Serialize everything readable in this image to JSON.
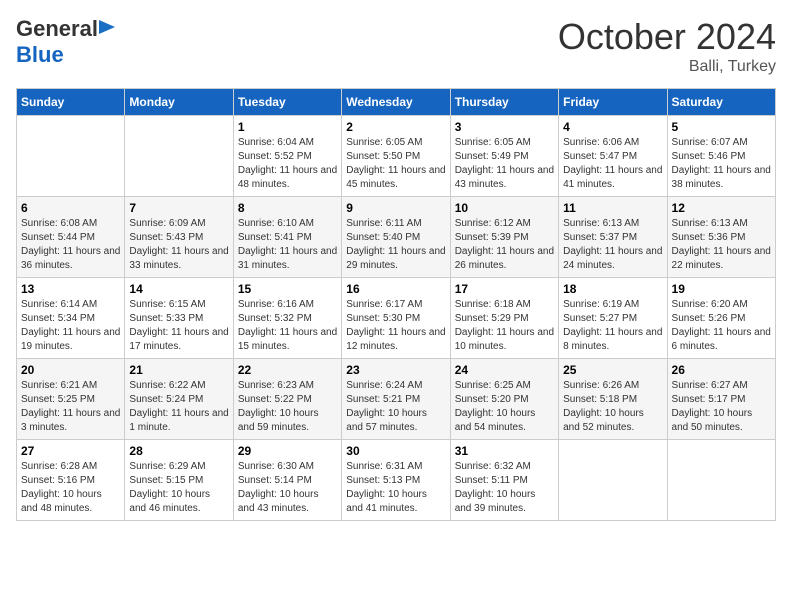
{
  "logo": {
    "general": "General",
    "blue": "Blue"
  },
  "title": "October 2024",
  "location": "Balli, Turkey",
  "days_header": [
    "Sunday",
    "Monday",
    "Tuesday",
    "Wednesday",
    "Thursday",
    "Friday",
    "Saturday"
  ],
  "weeks": [
    [
      {
        "day": "",
        "info": ""
      },
      {
        "day": "",
        "info": ""
      },
      {
        "day": "1",
        "info": "Sunrise: 6:04 AM\nSunset: 5:52 PM\nDaylight: 11 hours and 48 minutes."
      },
      {
        "day": "2",
        "info": "Sunrise: 6:05 AM\nSunset: 5:50 PM\nDaylight: 11 hours and 45 minutes."
      },
      {
        "day": "3",
        "info": "Sunrise: 6:05 AM\nSunset: 5:49 PM\nDaylight: 11 hours and 43 minutes."
      },
      {
        "day": "4",
        "info": "Sunrise: 6:06 AM\nSunset: 5:47 PM\nDaylight: 11 hours and 41 minutes."
      },
      {
        "day": "5",
        "info": "Sunrise: 6:07 AM\nSunset: 5:46 PM\nDaylight: 11 hours and 38 minutes."
      }
    ],
    [
      {
        "day": "6",
        "info": "Sunrise: 6:08 AM\nSunset: 5:44 PM\nDaylight: 11 hours and 36 minutes."
      },
      {
        "day": "7",
        "info": "Sunrise: 6:09 AM\nSunset: 5:43 PM\nDaylight: 11 hours and 33 minutes."
      },
      {
        "day": "8",
        "info": "Sunrise: 6:10 AM\nSunset: 5:41 PM\nDaylight: 11 hours and 31 minutes."
      },
      {
        "day": "9",
        "info": "Sunrise: 6:11 AM\nSunset: 5:40 PM\nDaylight: 11 hours and 29 minutes."
      },
      {
        "day": "10",
        "info": "Sunrise: 6:12 AM\nSunset: 5:39 PM\nDaylight: 11 hours and 26 minutes."
      },
      {
        "day": "11",
        "info": "Sunrise: 6:13 AM\nSunset: 5:37 PM\nDaylight: 11 hours and 24 minutes."
      },
      {
        "day": "12",
        "info": "Sunrise: 6:13 AM\nSunset: 5:36 PM\nDaylight: 11 hours and 22 minutes."
      }
    ],
    [
      {
        "day": "13",
        "info": "Sunrise: 6:14 AM\nSunset: 5:34 PM\nDaylight: 11 hours and 19 minutes."
      },
      {
        "day": "14",
        "info": "Sunrise: 6:15 AM\nSunset: 5:33 PM\nDaylight: 11 hours and 17 minutes."
      },
      {
        "day": "15",
        "info": "Sunrise: 6:16 AM\nSunset: 5:32 PM\nDaylight: 11 hours and 15 minutes."
      },
      {
        "day": "16",
        "info": "Sunrise: 6:17 AM\nSunset: 5:30 PM\nDaylight: 11 hours and 12 minutes."
      },
      {
        "day": "17",
        "info": "Sunrise: 6:18 AM\nSunset: 5:29 PM\nDaylight: 11 hours and 10 minutes."
      },
      {
        "day": "18",
        "info": "Sunrise: 6:19 AM\nSunset: 5:27 PM\nDaylight: 11 hours and 8 minutes."
      },
      {
        "day": "19",
        "info": "Sunrise: 6:20 AM\nSunset: 5:26 PM\nDaylight: 11 hours and 6 minutes."
      }
    ],
    [
      {
        "day": "20",
        "info": "Sunrise: 6:21 AM\nSunset: 5:25 PM\nDaylight: 11 hours and 3 minutes."
      },
      {
        "day": "21",
        "info": "Sunrise: 6:22 AM\nSunset: 5:24 PM\nDaylight: 11 hours and 1 minute."
      },
      {
        "day": "22",
        "info": "Sunrise: 6:23 AM\nSunset: 5:22 PM\nDaylight: 10 hours and 59 minutes."
      },
      {
        "day": "23",
        "info": "Sunrise: 6:24 AM\nSunset: 5:21 PM\nDaylight: 10 hours and 57 minutes."
      },
      {
        "day": "24",
        "info": "Sunrise: 6:25 AM\nSunset: 5:20 PM\nDaylight: 10 hours and 54 minutes."
      },
      {
        "day": "25",
        "info": "Sunrise: 6:26 AM\nSunset: 5:18 PM\nDaylight: 10 hours and 52 minutes."
      },
      {
        "day": "26",
        "info": "Sunrise: 6:27 AM\nSunset: 5:17 PM\nDaylight: 10 hours and 50 minutes."
      }
    ],
    [
      {
        "day": "27",
        "info": "Sunrise: 6:28 AM\nSunset: 5:16 PM\nDaylight: 10 hours and 48 minutes."
      },
      {
        "day": "28",
        "info": "Sunrise: 6:29 AM\nSunset: 5:15 PM\nDaylight: 10 hours and 46 minutes."
      },
      {
        "day": "29",
        "info": "Sunrise: 6:30 AM\nSunset: 5:14 PM\nDaylight: 10 hours and 43 minutes."
      },
      {
        "day": "30",
        "info": "Sunrise: 6:31 AM\nSunset: 5:13 PM\nDaylight: 10 hours and 41 minutes."
      },
      {
        "day": "31",
        "info": "Sunrise: 6:32 AM\nSunset: 5:11 PM\nDaylight: 10 hours and 39 minutes."
      },
      {
        "day": "",
        "info": ""
      },
      {
        "day": "",
        "info": ""
      }
    ]
  ]
}
